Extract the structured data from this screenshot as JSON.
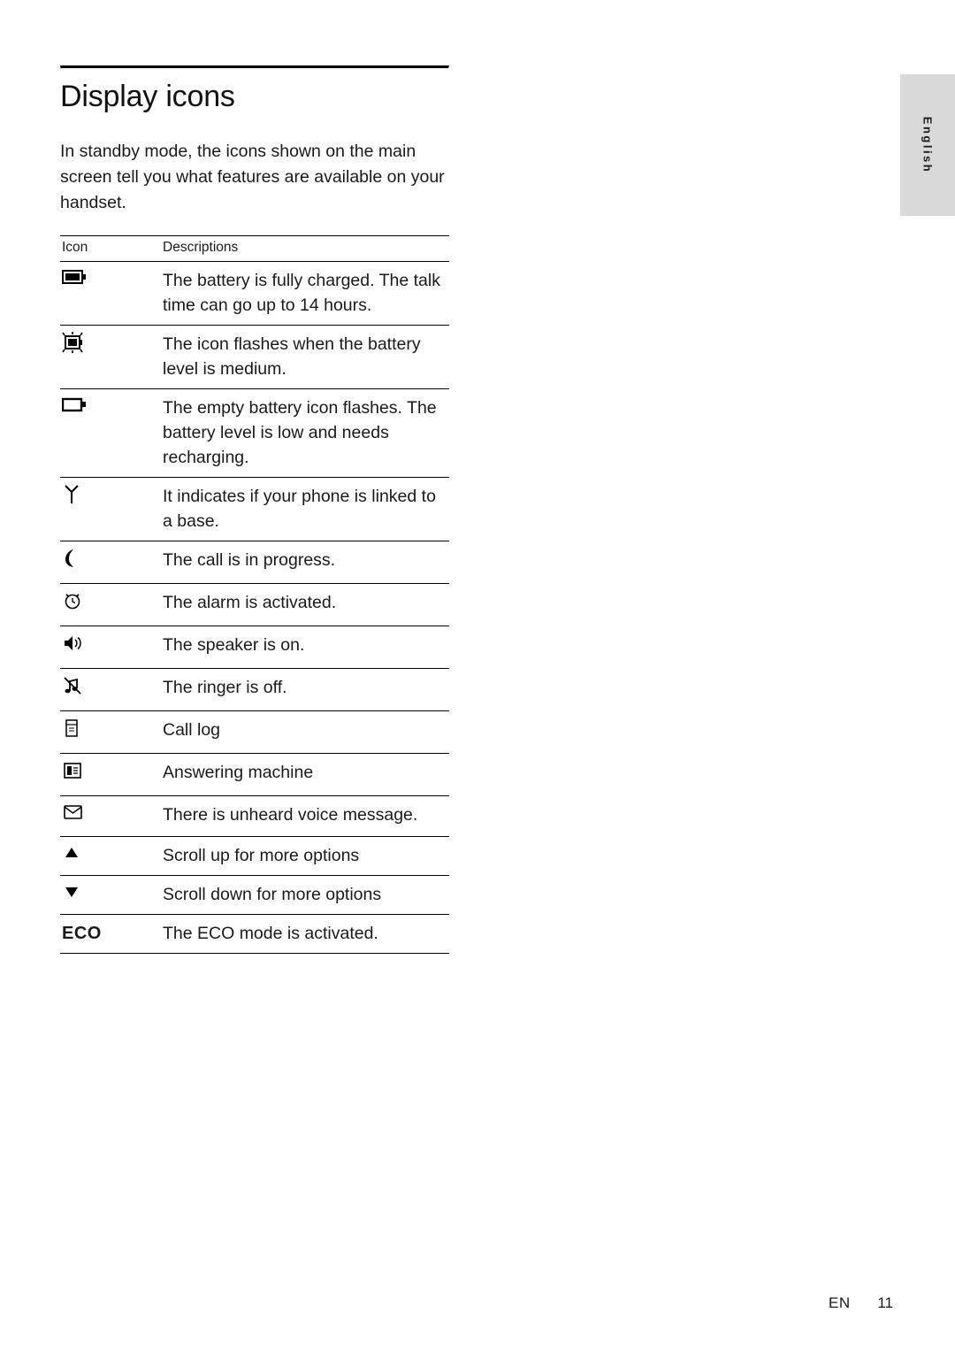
{
  "side_tab": {
    "label": "English"
  },
  "page": {
    "title": "Display icons",
    "intro": "In standby mode, the icons shown on the main screen tell you what features are available on your handset."
  },
  "table": {
    "headers": {
      "icon": "Icon",
      "description": "Descriptions"
    },
    "rows": [
      {
        "icon_name": "battery-full-icon",
        "description": "The battery is fully charged. The talk time can go up to 14 hours."
      },
      {
        "icon_name": "battery-medium-flashing-icon",
        "description": "The icon flashes when the battery level is medium."
      },
      {
        "icon_name": "battery-empty-icon",
        "description": "The empty battery icon flashes. The battery level is low and needs recharging."
      },
      {
        "icon_name": "antenna-link-icon",
        "description": "It indicates if your phone is linked to a base."
      },
      {
        "icon_name": "handset-call-icon",
        "description": "The call is in progress."
      },
      {
        "icon_name": "alarm-clock-icon",
        "description": "The alarm is activated."
      },
      {
        "icon_name": "speaker-on-icon",
        "description": "The speaker is on."
      },
      {
        "icon_name": "ringer-off-icon",
        "description": "The ringer is off."
      },
      {
        "icon_name": "call-log-icon",
        "description": "Call log"
      },
      {
        "icon_name": "answering-machine-icon",
        "description": "Answering machine"
      },
      {
        "icon_name": "voice-message-envelope-icon",
        "description": "There is unheard voice message."
      },
      {
        "icon_name": "scroll-up-arrow-icon",
        "description": "Scroll up for more options"
      },
      {
        "icon_name": "scroll-down-arrow-icon",
        "description": "Scroll down for more options"
      },
      {
        "icon_name": "eco-text-icon",
        "icon_text": "ECO",
        "description": "The ECO mode is activated."
      }
    ]
  },
  "footer": {
    "language_code": "EN",
    "page_number": "11"
  }
}
